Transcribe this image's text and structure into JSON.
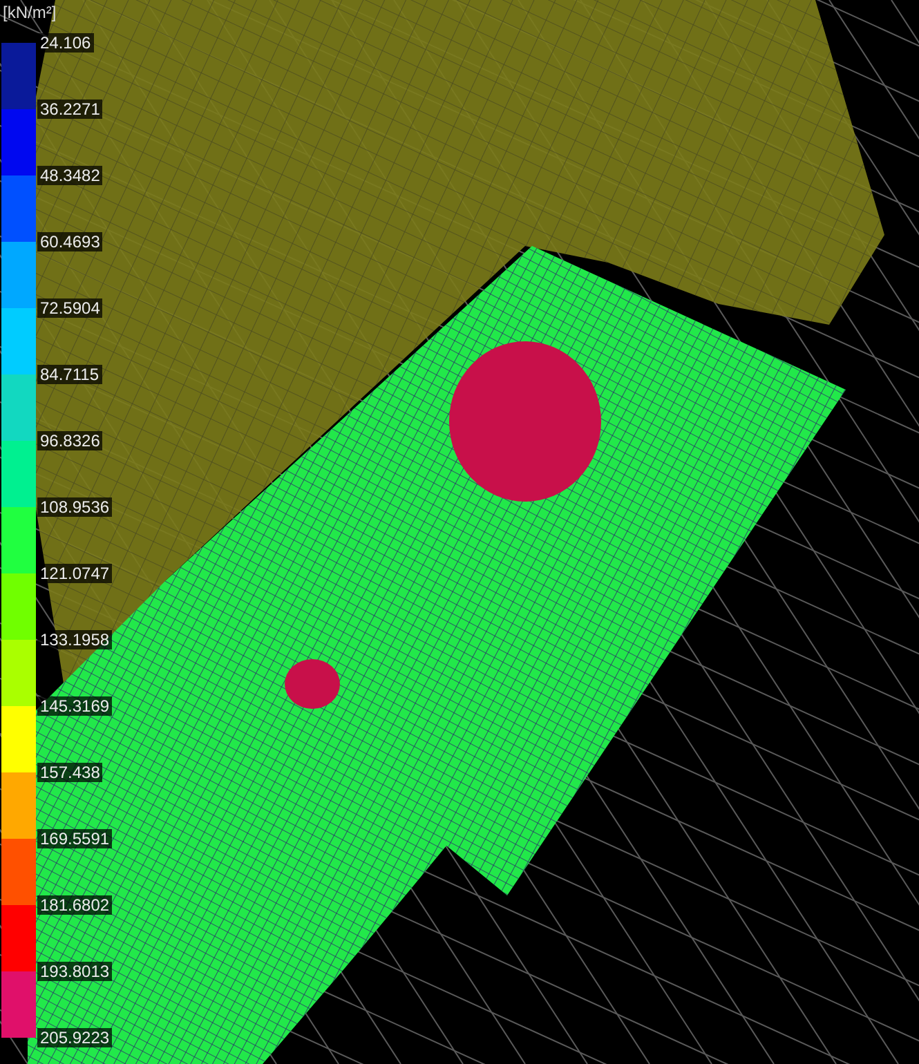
{
  "legend": {
    "unit": "[kN/m²]",
    "bands": [
      {
        "color": "#0a1a9a"
      },
      {
        "color": "#0008f0"
      },
      {
        "color": "#0050ff"
      },
      {
        "color": "#00a8ff"
      },
      {
        "color": "#00ccff"
      },
      {
        "color": "#12d8c0"
      },
      {
        "color": "#00f090"
      },
      {
        "color": "#20ff40"
      },
      {
        "color": "#70ff00"
      },
      {
        "color": "#aaff00"
      },
      {
        "color": "#ffff00"
      },
      {
        "color": "#ffa800"
      },
      {
        "color": "#ff5000"
      },
      {
        "color": "#ff0000"
      },
      {
        "color": "#e0106a"
      }
    ],
    "ticks": [
      "24.106",
      "36.2271",
      "48.3482",
      "60.4693",
      "72.5904",
      "84.7115",
      "96.8326",
      "108.9536",
      "121.0747",
      "133.1958",
      "145.3169",
      "157.438",
      "169.5591",
      "181.6802",
      "193.8013",
      "205.9223"
    ]
  }
}
